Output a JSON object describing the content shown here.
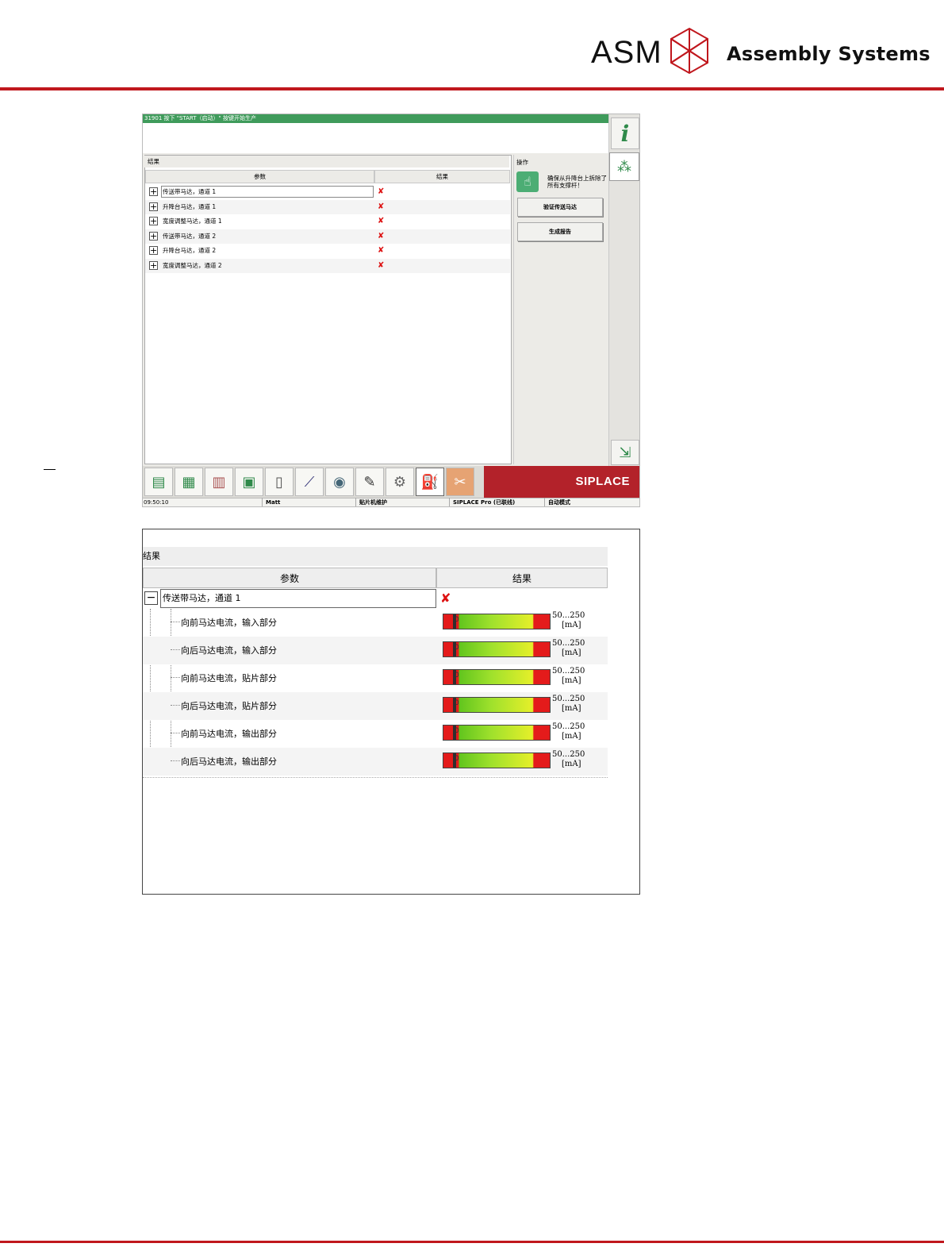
{
  "header": {
    "logo_text": "ASM",
    "tagline": "Assembly Systems",
    "brand_color": "#c0171d"
  },
  "screen1": {
    "message": "31901 按下 \"START（启动）\" 按键开始生产",
    "results_title": "结果",
    "col_param": "参数",
    "col_result": "结果",
    "rows": [
      {
        "label": "传送带马达，通道 1",
        "result": "✘"
      },
      {
        "label": "升降台马达，通道 1",
        "result": "✘"
      },
      {
        "label": "宽度调整马达，通道 1",
        "result": "✘"
      },
      {
        "label": "传送带马达，通道 2",
        "result": "✘"
      },
      {
        "label": "升降台马达，通道 2",
        "result": "✘"
      },
      {
        "label": "宽度调整马达，通道 2",
        "result": "✘"
      }
    ],
    "ops_title": "操作",
    "ops_instruction": "确保从升降台上拆除了所有支撑杆！",
    "btn_verify": "验证传送马达",
    "btn_report": "生成报告",
    "brand": "SIPLACE",
    "status": {
      "time": "09:50:10",
      "user": "Matt",
      "machine": "贴片机维护",
      "line": "SIPLACE Pro (已联线)",
      "mode": "自动模式"
    },
    "toolbar_icons": [
      "stack-icon",
      "grid-icon",
      "bar-icon",
      "board-icon",
      "info-card-icon",
      "chart-icon",
      "camera-icon",
      "pen-icon",
      "gears-icon",
      "oilcan-icon",
      "wrench-icon"
    ]
  },
  "screen2": {
    "results_title": "结果",
    "col_param": "参数",
    "col_result": "结果",
    "parent": {
      "label": "传送带马达，通道 1",
      "result": "✘"
    },
    "children": [
      {
        "label": "向前马达电流，输入部分",
        "value": "0",
        "range": "50...250",
        "unit": "[mA]"
      },
      {
        "label": "向后马达电流，输入部分",
        "value": "0",
        "range": "50...250",
        "unit": "[mA]"
      },
      {
        "label": "向前马达电流，贴片部分",
        "value": "0",
        "range": "50...250",
        "unit": "[mA]"
      },
      {
        "label": "向后马达电流，贴片部分",
        "value": "0",
        "range": "50...250",
        "unit": "[mA]"
      },
      {
        "label": "向前马达电流，输出部分",
        "value": "0",
        "range": "50...250",
        "unit": "[mA]"
      },
      {
        "label": "向后马达电流，输出部分",
        "value": "0",
        "range": "50...250",
        "unit": "[mA]"
      }
    ]
  }
}
